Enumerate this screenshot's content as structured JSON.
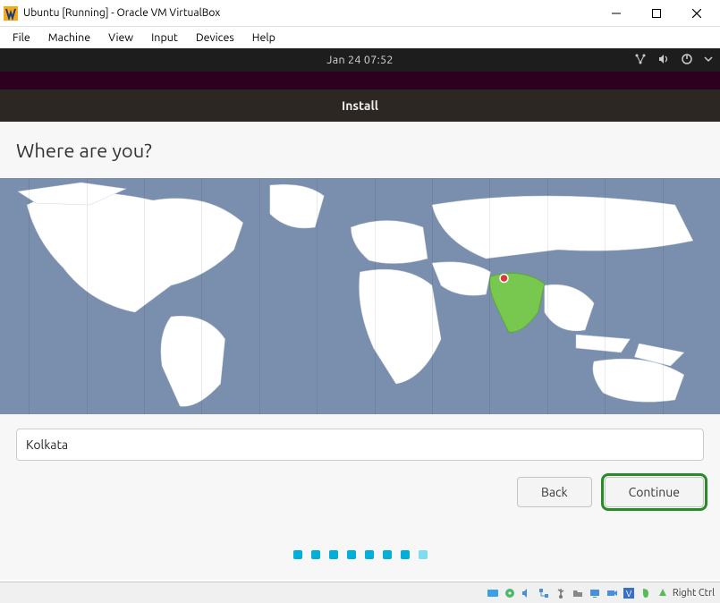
{
  "window": {
    "title": "Ubuntu [Running] - Oracle VM VirtualBox"
  },
  "menubar": {
    "items": [
      "File",
      "Machine",
      "View",
      "Input",
      "Devices",
      "Help"
    ]
  },
  "gnome": {
    "clock": "Jan 24  07:52"
  },
  "installer": {
    "header": "Install",
    "heading": "Where are you?",
    "location_value": "Kolkata",
    "buttons": {
      "back": "Back",
      "continue": "Continue"
    },
    "progress_dots": 8,
    "progress_current": 7
  },
  "statusbar": {
    "host_key": "Right Ctrl"
  }
}
